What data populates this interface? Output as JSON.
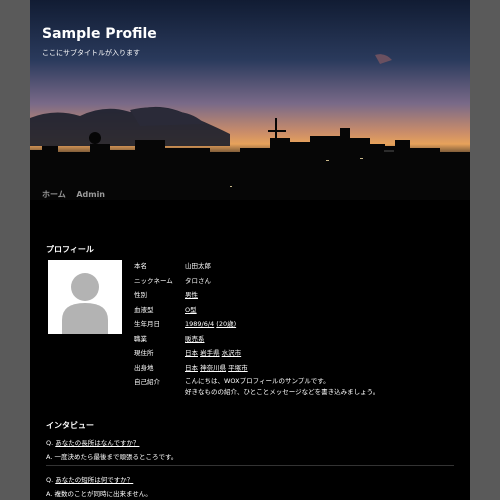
{
  "site": {
    "title": "Sample Profile",
    "subtitle": "ここにサブタイトルが入ります"
  },
  "nav": [
    {
      "label": "ホーム"
    },
    {
      "label": "Admin"
    }
  ],
  "profile": {
    "heading": "プロフィール",
    "rows": [
      {
        "label": "本名",
        "value": "山田太郎"
      },
      {
        "label": "ニックネーム",
        "value": "タロさん"
      },
      {
        "label": "性別",
        "value": "男性"
      },
      {
        "label": "血液型",
        "value": "O型"
      },
      {
        "label": "生年月日",
        "value_main": "1989/6/4",
        "value_extra": "(20歳)"
      },
      {
        "label": "職業",
        "value": "販売系"
      },
      {
        "label": "現住所",
        "parts": [
          "日本",
          "岩手県",
          "水沢市"
        ]
      },
      {
        "label": "出身地",
        "parts": [
          "日本",
          "神奈川県",
          "平塚市"
        ]
      },
      {
        "label": "自己紹介",
        "lines": [
          "こんにちは、WOXプロフィールのサンプルです。",
          "好きなものの紹介、ひとことメッセージなどを書き込みましょう。"
        ]
      }
    ]
  },
  "interview": {
    "heading": "インタビュー",
    "items": [
      {
        "q_prefix": "Q.",
        "q": "あなたの長所はなんですか？",
        "a_prefix": "A.",
        "a": "一度決めたら最後まで頑張るところです。"
      },
      {
        "q_prefix": "Q.",
        "q": "あなたの短所は何ですか？",
        "a_prefix": "A.",
        "a": "複数のことが同時に出来ません。"
      }
    ]
  },
  "colors": {
    "background": "#5a5a5a",
    "page": "#000000",
    "text": "#ffffff",
    "nav_text": "#9a9a9a"
  }
}
